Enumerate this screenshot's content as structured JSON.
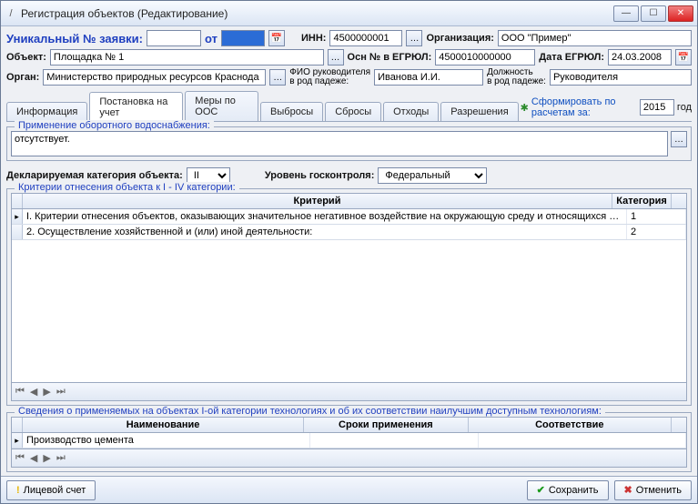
{
  "window": {
    "title": "Регистрация объектов (Редактирование)"
  },
  "header": {
    "uniq_label": "Уникальный № заявки:",
    "uniq_value": "",
    "ot_label": "от",
    "ot_value": "",
    "inn_label": "ИНН:",
    "inn_value": "4500000001",
    "org_label": "Организация:",
    "org_value": "ООО \"Пример\""
  },
  "row2": {
    "object_label": "Объект:",
    "object_value": "Площадка № 1",
    "osn_label": "Осн № в ЕГРЮЛ:",
    "osn_value": "4500010000000",
    "date_label": "Дата ЕГРЮЛ:",
    "date_value": "24.03.2008"
  },
  "row3": {
    "organ_label": "Орган:",
    "organ_value": "Министерство природных ресурсов Краснода",
    "fio_label1": "ФИО руководителя",
    "fio_label2": "в род падеже:",
    "fio_value": "Иванова И.И.",
    "pos_label1": "Должность",
    "pos_label2": "в род падеже:",
    "pos_value": "Руководителя"
  },
  "tabs": {
    "items": [
      "Информация",
      "Постановка на учет",
      "Меры по ООС",
      "Выбросы",
      "Сбросы",
      "Отходы",
      "Разрешения"
    ],
    "active": 1,
    "calc_label": "Сформировать по расчетам за:",
    "calc_year": "2015",
    "calc_suffix": "год"
  },
  "oborot": {
    "legend": "Применение оборотного водоснабжения:",
    "text": "отсутствует."
  },
  "declared": {
    "cat_label": "Декларируемая категория объекта:",
    "cat_value": "II",
    "level_label": "Уровень госконтроля:",
    "level_value": "Федеральный"
  },
  "criteria": {
    "legend": "Критерии отнесения объекта к I - IV категории:",
    "headers": {
      "c1": "Критерий",
      "c2": "Категория"
    },
    "rows": [
      {
        "text": "I. Критерии отнесения объектов, оказывающих значительное негативное воздействие на окружающую среду и относящихся к областям применения наилучши",
        "cat": "1"
      },
      {
        "text": "2. Осуществление хозяйственной и (или) иной деятельности:",
        "cat": "2"
      }
    ]
  },
  "tech": {
    "legend": "Сведения о применяемых на объектах I-ой категории технологиях и об их соответствии наилучшим доступным технологиям:",
    "headers": {
      "c1": "Наименование",
      "c2": "Сроки применения",
      "c3": "Соответствие"
    },
    "rows": [
      {
        "name": "Производство цемента",
        "term": "",
        "match": ""
      }
    ]
  },
  "footer": {
    "account": "Лицевой счет",
    "save": "Сохранить",
    "cancel": "Отменить"
  }
}
